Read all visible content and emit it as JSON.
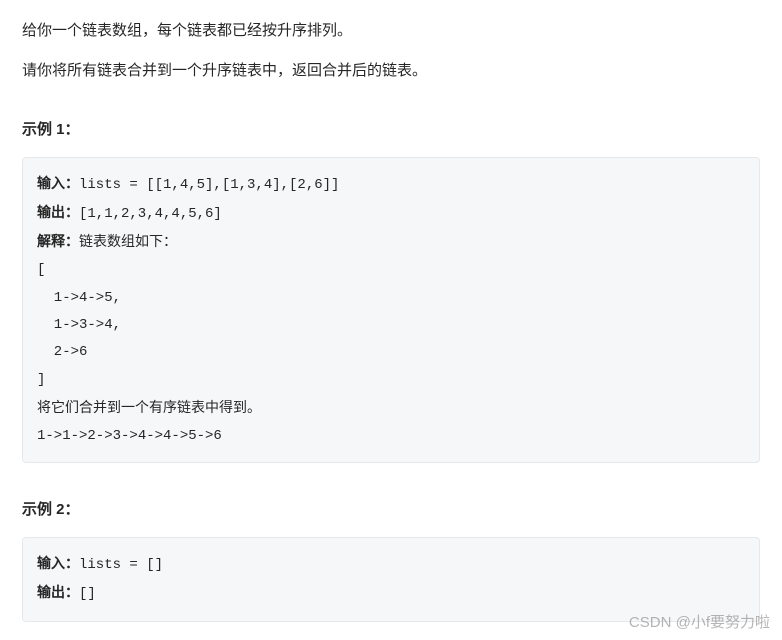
{
  "intro": {
    "p1": "给你一个链表数组，每个链表都已经按升序排列。",
    "p2": "请你将所有链表合并到一个升序链表中，返回合并后的链表。"
  },
  "example1": {
    "heading": "示例 1：",
    "input_label": "输入：",
    "input_value": "lists = [[1,4,5],[1,3,4],[2,6]]",
    "output_label": "输出：",
    "output_value": "[1,1,2,3,4,4,5,6]",
    "explain_label": "解释：",
    "explain_value": "链表数组如下：",
    "list_open": "[",
    "list_item1": "  1->4->5,",
    "list_item2": "  1->3->4,",
    "list_item3": "  2->6",
    "list_close": "]",
    "merge_text": "将它们合并到一个有序链表中得到。",
    "merge_result": "1->1->2->3->4->4->5->6"
  },
  "example2": {
    "heading": "示例 2：",
    "input_label": "输入：",
    "input_value": "lists = []",
    "output_label": "输出：",
    "output_value": "[]"
  },
  "watermark": "CSDN @小f要努力啦"
}
